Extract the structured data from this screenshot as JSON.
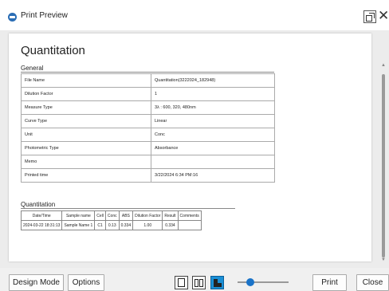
{
  "window": {
    "title": "Print Preview"
  },
  "report": {
    "title": "Quantitation",
    "general_heading": "General",
    "general_rows": [
      {
        "key": "File Name",
        "value": "Quantitation(3222024_182948)"
      },
      {
        "key": "Dilution Factor",
        "value": "1"
      },
      {
        "key": "Measure Type",
        "value": "3λ : 600, 320, 480nm"
      },
      {
        "key": "Curve Type",
        "value": "Linear"
      },
      {
        "key": "Unit",
        "value": "Conc"
      },
      {
        "key": "Photometric Type",
        "value": "Absorbance"
      },
      {
        "key": "Memo",
        "value": ""
      },
      {
        "key": "Printed time",
        "value": "3/22/2024 6:34 PM:16"
      }
    ],
    "quant_heading": "Quantitation",
    "quant_columns": [
      "Date/Time",
      "Sample name",
      "Cell",
      "Conc",
      "ABS",
      "Dilution Factor",
      "Result",
      "Comments"
    ],
    "quant_rows": [
      [
        "2024-03-22 18:31:13",
        "Sample Name 1",
        "C1",
        "0.13",
        "0.334",
        "1.00",
        "0.334",
        ""
      ]
    ]
  },
  "toolbar": {
    "design_mode": "Design Mode",
    "options": "Options",
    "print": "Print",
    "close": "Close",
    "zoom_level": 0.25
  },
  "icons": {
    "app": "app-logo-icon",
    "restore": "restore-window-icon",
    "close": "close-icon",
    "single_page": "single-page-view-icon",
    "two_page": "two-page-view-icon",
    "multi_page": "multi-page-view-icon"
  },
  "colors": {
    "accent": "#1a8fd6",
    "slider": "#1a73c8"
  }
}
